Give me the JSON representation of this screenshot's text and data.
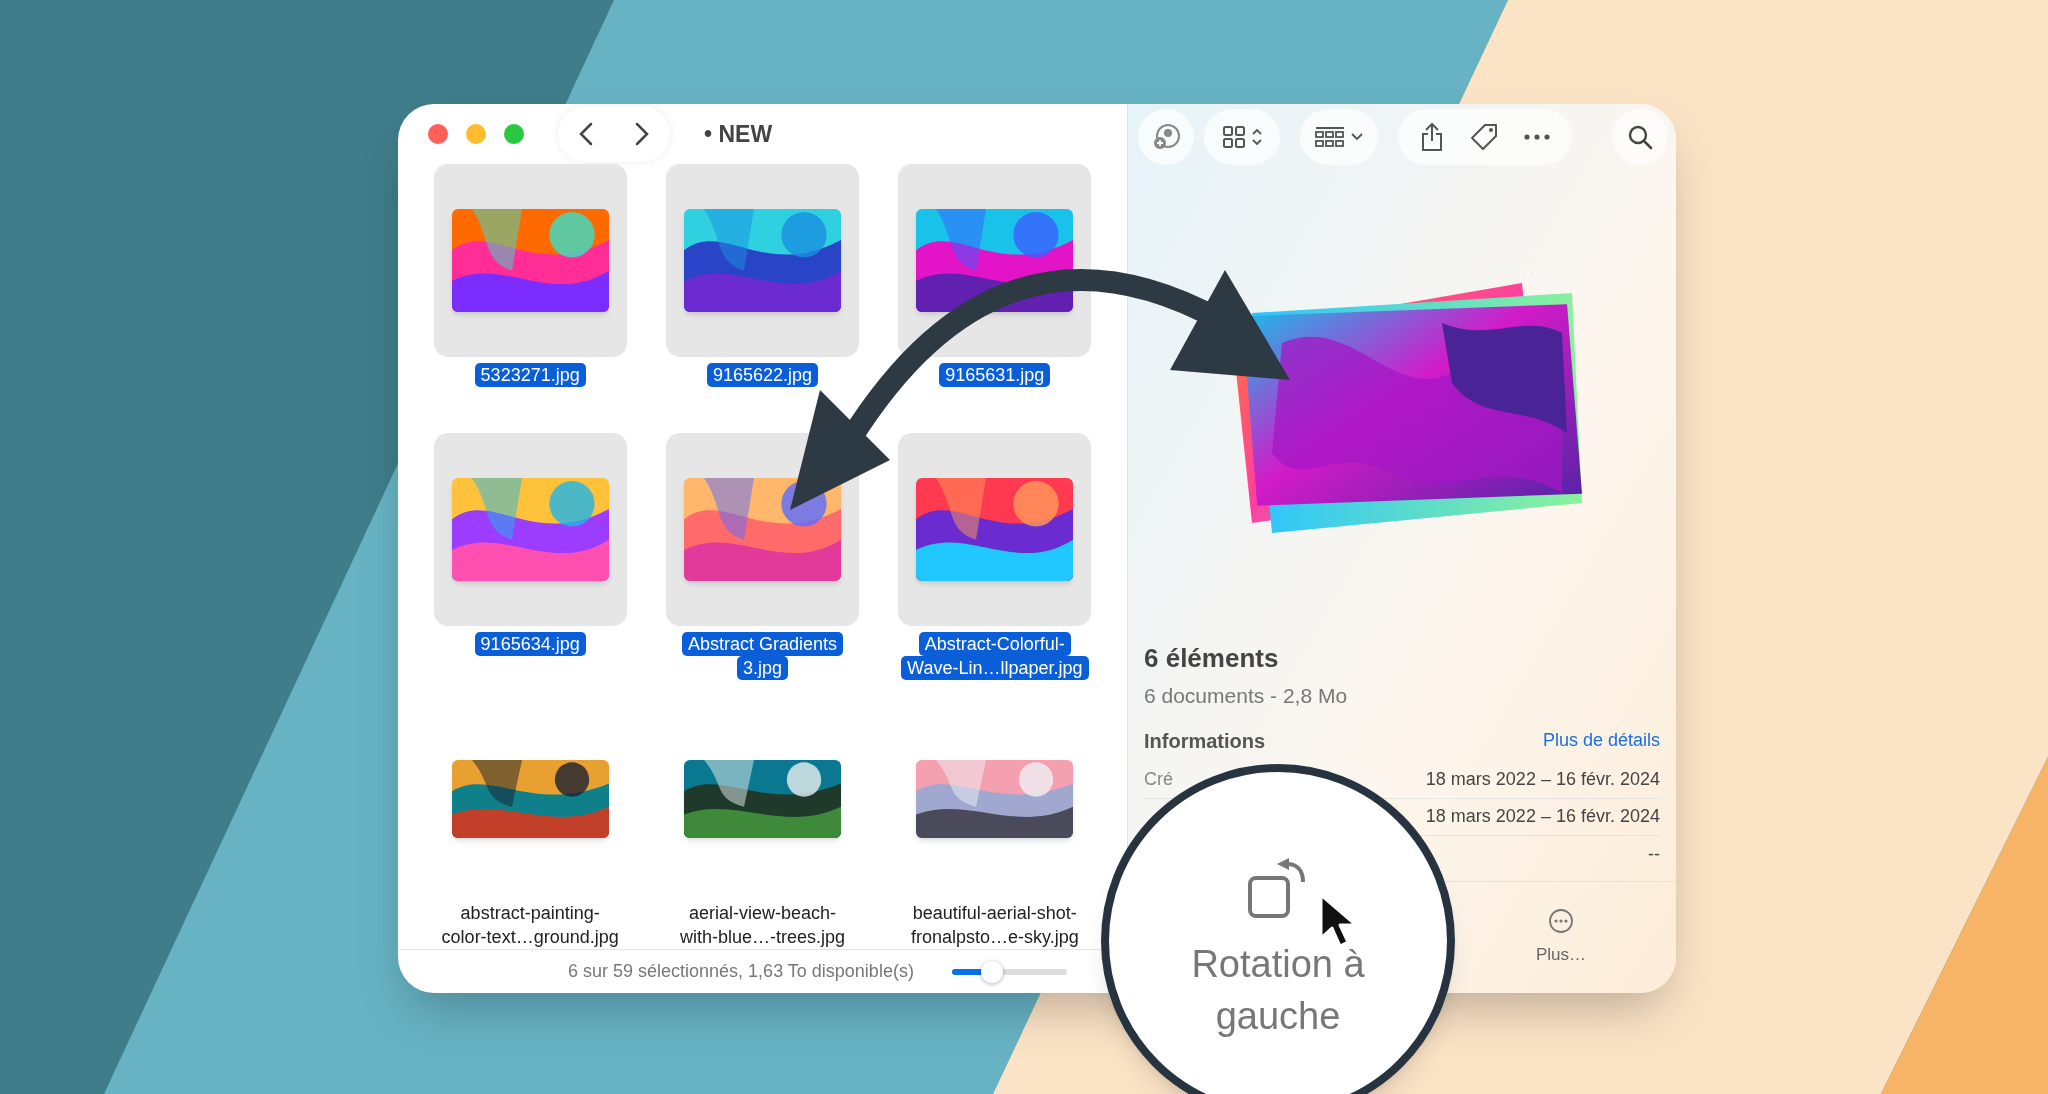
{
  "window": {
    "title": "• NEW"
  },
  "files": [
    {
      "lines": [
        "5323271.jpg"
      ],
      "selected": true
    },
    {
      "lines": [
        "9165622.jpg"
      ],
      "selected": true
    },
    {
      "lines": [
        "9165631.jpg"
      ],
      "selected": true
    },
    {
      "lines": [
        "9165634.jpg"
      ],
      "selected": true
    },
    {
      "lines": [
        "Abstract Gradients",
        "3.jpg"
      ],
      "selected": true
    },
    {
      "lines": [
        "Abstract-Colorful-",
        "Wave-Lin…llpaper.jpg"
      ],
      "selected": true
    },
    {
      "lines": [
        "abstract-painting-",
        "color-text…ground.jpg"
      ],
      "selected": false
    },
    {
      "lines": [
        "aerial-view-beach-",
        "with-blue…-trees.jpg"
      ],
      "selected": false
    },
    {
      "lines": [
        "beautiful-aerial-shot-",
        "fronalpsto…e-sky.jpg"
      ],
      "selected": false
    }
  ],
  "status_bar": {
    "text": "6 sur 59 sélectionnés, 1,63 To disponible(s)",
    "zoom_slider": {
      "level": 0.35
    }
  },
  "inspector": {
    "title": "6 éléments",
    "subtitle": "6 documents - 2,8 Mo",
    "section": "Informations",
    "link": "Plus de détails",
    "rows": [
      {
        "label": "Cré",
        "value": "18 mars 2022 – 16 févr. 2024"
      },
      {
        "value": "18 mars 2022 – 16 févr. 2024"
      },
      {
        "value": "--"
      }
    ],
    "actions": [
      {
        "label": "Plus…"
      }
    ]
  },
  "magnifier": {
    "label": "Rotation à gauche"
  }
}
